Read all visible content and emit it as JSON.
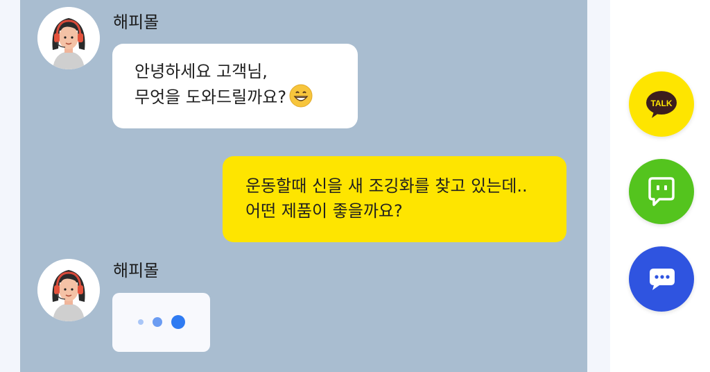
{
  "colors": {
    "chat_background": "#a9bdd0",
    "page_background": "#f3f6fc",
    "incoming_bubble": "#ffffff",
    "outgoing_bubble": "#fee500",
    "kakao_yellow": "#fee500",
    "talk_green": "#54c41e",
    "chat_blue": "#2f54e0",
    "typing_dot_small": "#a9c6f7",
    "typing_dot_medium": "#6b9cf2",
    "typing_dot_large": "#2f7bf2"
  },
  "messages": [
    {
      "type": "incoming",
      "sender": "해피몰",
      "avatar_icon": "agent-headset-avatar",
      "lines": [
        "안녕하세요 고객님,",
        "무엇을 도와드릴까요?"
      ],
      "emoji": "grinning-face-icon"
    },
    {
      "type": "outgoing",
      "lines": [
        "운동할때 신을 새 조깅화를 찾고 있는데..",
        "어떤 제품이 좋을까요?"
      ]
    },
    {
      "type": "incoming",
      "sender": "해피몰",
      "avatar_icon": "agent-headset-avatar",
      "typing": true
    }
  ],
  "floating_buttons": [
    {
      "name": "kakaotalk-button",
      "label": "TALK",
      "icon": "kakaotalk-icon",
      "color": "#fee500"
    },
    {
      "name": "talktalk-button",
      "icon": "talktalk-icon",
      "color": "#54c41e"
    },
    {
      "name": "chat-button",
      "icon": "chat-bubble-icon",
      "color": "#2f54e0"
    }
  ]
}
